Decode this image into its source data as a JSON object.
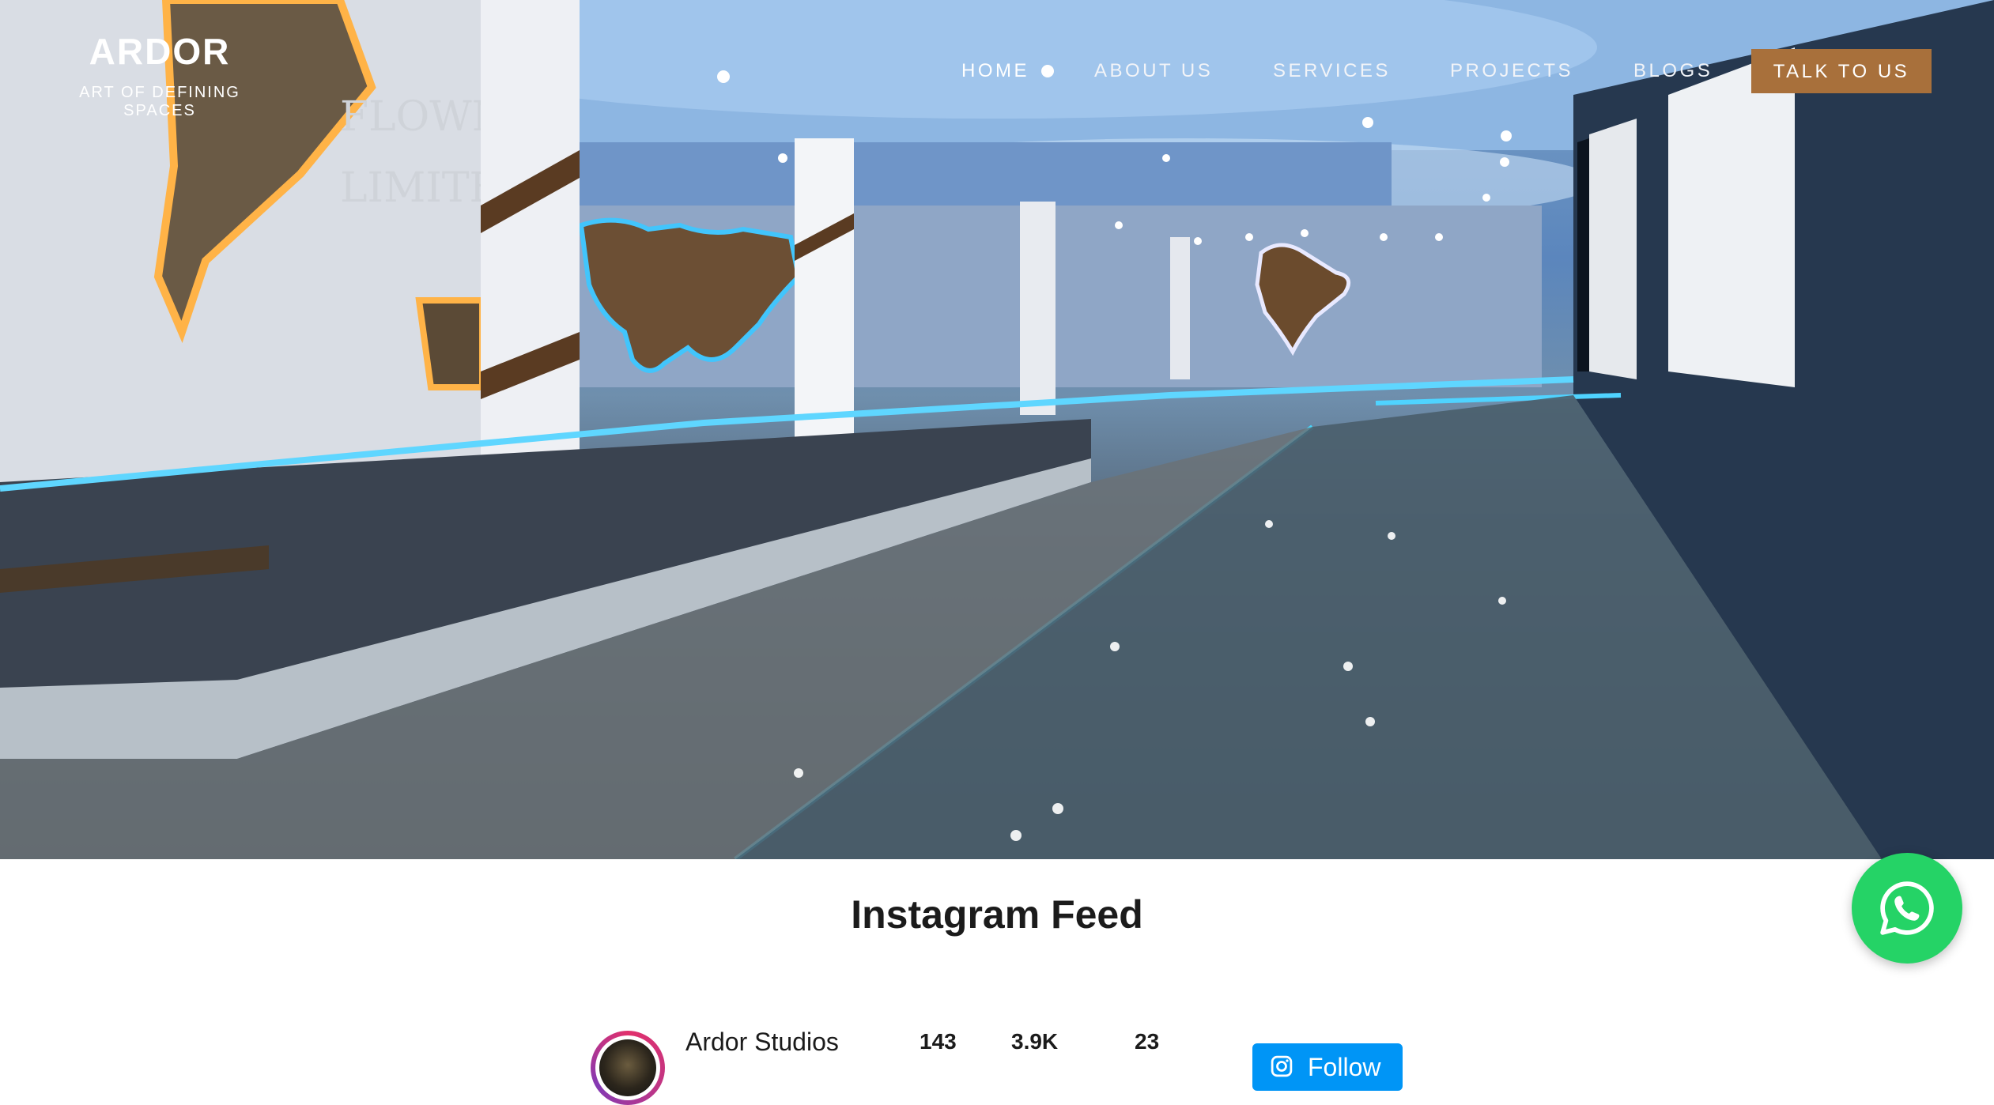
{
  "brand": {
    "name": "ARDOR",
    "tagline": "ART OF DEFINING SPACES"
  },
  "nav": {
    "items": [
      {
        "label": "HOME",
        "active": true
      },
      {
        "label": "ABOUT US"
      },
      {
        "label": "SERVICES"
      },
      {
        "label": "PROJECTS"
      },
      {
        "label": "BLOGS"
      }
    ],
    "cta_label": "TALK TO US",
    "cta_color": "#a8703b"
  },
  "hero": {
    "wall_sign": [
      "FLOWM",
      "LIMITE"
    ],
    "icons": [
      "world-map",
      "india-map"
    ]
  },
  "instagram": {
    "title": "Instagram Feed",
    "profile_name": "Ardor Studios",
    "stats": [
      "143",
      "3.9K",
      "23"
    ],
    "follow_label": "Follow",
    "follow_color": "#0095f6"
  },
  "whatsapp": {
    "icon": "whatsapp-icon",
    "color": "#25d366"
  }
}
